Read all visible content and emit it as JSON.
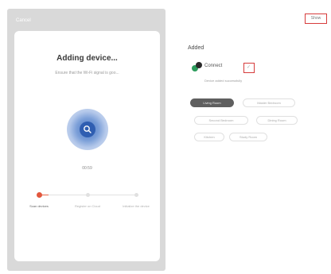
{
  "phone": {
    "cancel_label": "Cancel",
    "title": "Adding device...",
    "subtitle": "Ensure that the Wi-Fi signal is goo...",
    "progress_label": "00:59",
    "progress_fraction": 0.1,
    "steps": [
      {
        "label": "Scan devices",
        "active": true
      },
      {
        "label": "Register on Cloud",
        "active": false
      },
      {
        "label": "Initialize the device",
        "active": false
      }
    ]
  },
  "right": {
    "show_label": "Show",
    "section_title": "Added",
    "device": {
      "name": "Connect",
      "check_glyph": "✓",
      "description": "Device added successfully"
    },
    "rooms": [
      {
        "label": "Living Room",
        "selected": true
      },
      {
        "label": "Master Bedroom",
        "selected": false
      },
      {
        "label": "Second Bedroom",
        "selected": false
      },
      {
        "label": "Dining Room",
        "selected": false
      },
      {
        "label": "Kitchen",
        "selected": false
      },
      {
        "label": "Study Room",
        "selected": false
      }
    ]
  },
  "colors": {
    "accent": "#e2573d",
    "highlight_box": "#d63b3b",
    "radar": "#2f5eb1"
  },
  "icons": {
    "search": "search-icon",
    "device": "device-icon",
    "check": "check-icon"
  }
}
